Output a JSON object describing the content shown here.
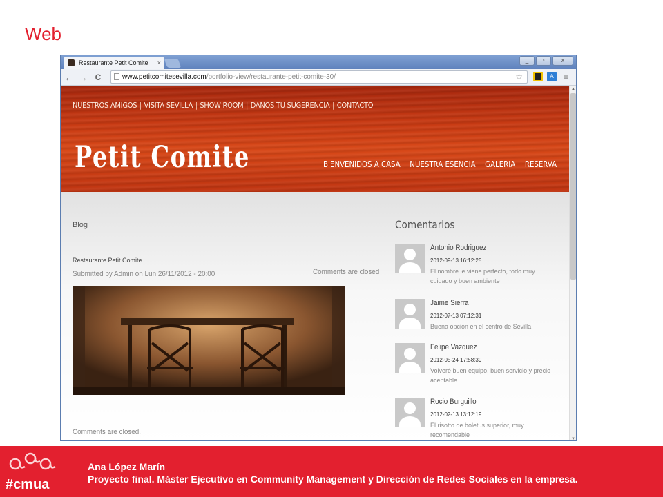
{
  "slide": {
    "title": "Web"
  },
  "browser": {
    "tab_title": "Restaurante Petit Comite",
    "tab_close": "×",
    "window_buttons": [
      "_",
      "▫",
      "x"
    ],
    "nav": {
      "back": "←",
      "forward": "→",
      "reload": "C"
    },
    "url_domain": "www.petitcomitesevilla.com",
    "url_path": "/portfolio-view/restaurante-petit-comite-30/",
    "bookmark_star": "☆",
    "translate_ext": "A",
    "menu": "≡"
  },
  "site": {
    "top_nav": [
      "NUESTROS AMIGOS",
      "VISITA SEVILLA",
      "SHOW ROOM",
      "DANOS TU SUGERENCIA",
      "CONTACTO"
    ],
    "top_nav_separator": "|",
    "logo": "Petit Comite",
    "main_nav": [
      "BIENVENIDOS A CASA",
      "NUESTRA ESENCIA",
      "GALERIA",
      "RESERVA"
    ],
    "blog_label": "Blog",
    "post_title": "Restaurante Petit Comite",
    "submitted": "Submitted by Admin on Lun 26/11/2012 - 20:00",
    "comments_closed_right": "Comments are closed",
    "comments_closed_bottom": "Comments are closed.",
    "comments_title": "Comentarios",
    "comments": [
      {
        "name": "Antonio Rodriguez",
        "date": "2012-09-13 16:12:25",
        "text": "El nombre le viene perfecto, todo muy cuidado y buen ambiente"
      },
      {
        "name": "Jaime Sierra",
        "date": "2012-07-13 07:12:31",
        "text": "Buena opción en el centro de Sevilla"
      },
      {
        "name": "Felipe Vazquez",
        "date": "2012-05-24 17:58:39",
        "text": "Volveré buen equipo, buen servicio y precio aceptable"
      },
      {
        "name": "Rocio Burguillo",
        "date": "2012-02-13 13:12:19",
        "text": "El risotto de boletus superior, muy recomendable"
      }
    ]
  },
  "footer": {
    "author": "Ana López Marín",
    "project": "Proyecto final. Máster Ejecutivo en Community Management y Dirección de Redes Sociales en la empresa.",
    "logo_text": "#cmua"
  },
  "colors": {
    "accent_red": "#e3202f",
    "header_wood": "#c83a13"
  }
}
